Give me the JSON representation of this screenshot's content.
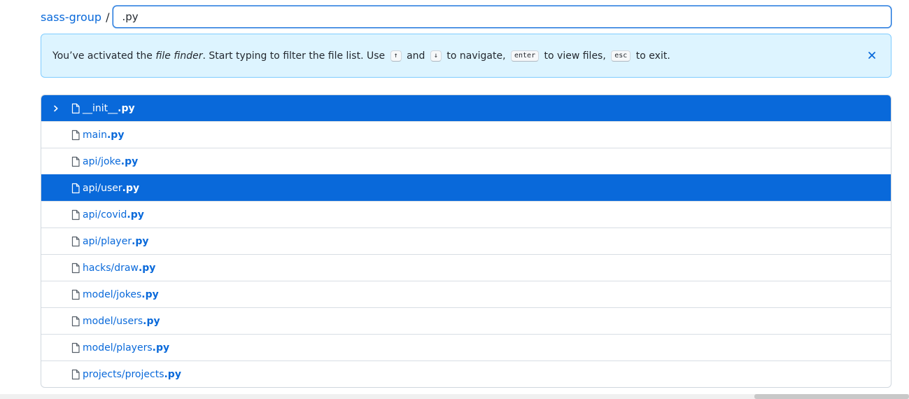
{
  "breadcrumb": {
    "repo": "sass-group",
    "separator": "/"
  },
  "search": {
    "value": ".py",
    "placeholder": ""
  },
  "notice": {
    "text_1": "You’ve activated the ",
    "emphasis": "file finder",
    "text_2": ". Start typing to filter the file list. Use ",
    "key_up": "↑",
    "text_and": "and",
    "key_down": "↓",
    "text_3": "to navigate,",
    "key_enter": "enter",
    "text_4": "to view files,",
    "key_esc": "esc",
    "text_5": "to exit.",
    "close_icon": "close-icon"
  },
  "files": [
    {
      "base": "__init__",
      "ext": ".py",
      "selected": true
    },
    {
      "base": "main",
      "ext": ".py",
      "selected": false
    },
    {
      "base": "api/joke",
      "ext": ".py",
      "selected": false
    },
    {
      "base": "api/user",
      "ext": ".py",
      "selected": true
    },
    {
      "base": "api/covid",
      "ext": ".py",
      "selected": false
    },
    {
      "base": "api/player",
      "ext": ".py",
      "selected": false
    },
    {
      "base": "hacks/draw",
      "ext": ".py",
      "selected": false
    },
    {
      "base": "model/jokes",
      "ext": ".py",
      "selected": false
    },
    {
      "base": "model/users",
      "ext": ".py",
      "selected": false
    },
    {
      "base": "model/players",
      "ext": ".py",
      "selected": false
    },
    {
      "base": "projects/projects",
      "ext": ".py",
      "selected": false
    }
  ],
  "colors": {
    "accent": "#0969da",
    "notice_bg": "#ddf4ff",
    "notice_border": "#80ccff"
  }
}
